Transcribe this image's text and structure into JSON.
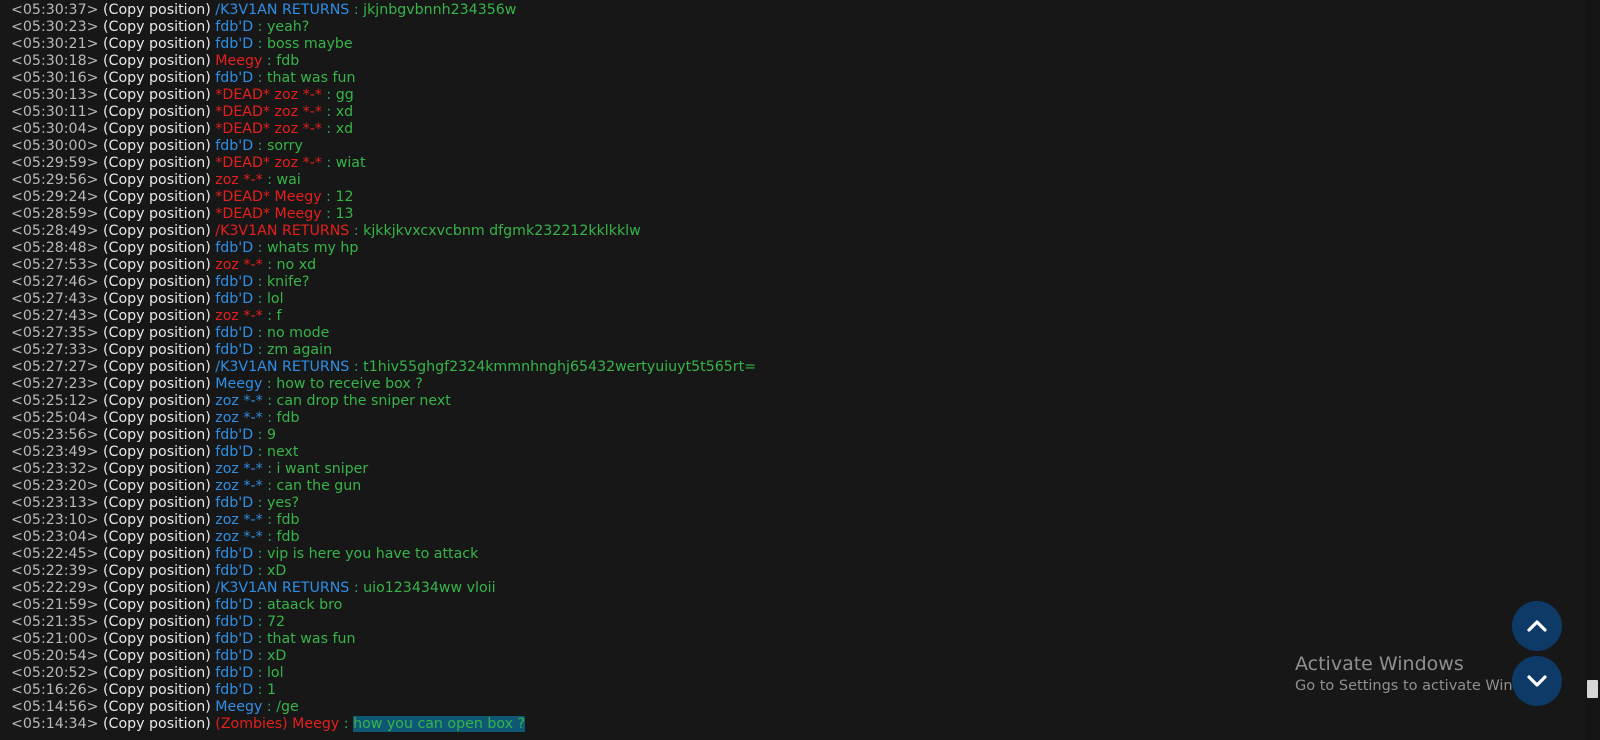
{
  "colors": {
    "background": "#171717",
    "timestamp": "#b9b9b9",
    "copy": "#e8e8e8",
    "name_blue": "#2e8fe6",
    "name_red": "#e5201c",
    "message": "#37b449",
    "selection": "#0e5876",
    "round_button": "#0d3a67"
  },
  "chat": {
    "copy_label": "(Copy position)",
    "separator": ":",
    "lines": [
      {
        "time": "<05:30:37>",
        "name": "/K3V1AN RETURNS",
        "color": "blue",
        "msg": "jkjnbgvbnnh234356w"
      },
      {
        "time": "<05:30:23>",
        "name": "fdb'D",
        "color": "blue",
        "msg": "yeah?"
      },
      {
        "time": "<05:30:21>",
        "name": "fdb'D",
        "color": "blue",
        "msg": "boss maybe"
      },
      {
        "time": "<05:30:18>",
        "name": "Meegy",
        "color": "red",
        "msg": "fdb"
      },
      {
        "time": "<05:30:16>",
        "name": "fdb'D",
        "color": "blue",
        "msg": "that was fun"
      },
      {
        "time": "<05:30:13>",
        "name": "*DEAD* zoz *-*",
        "color": "red",
        "msg": "gg"
      },
      {
        "time": "<05:30:11>",
        "name": "*DEAD* zoz *-*",
        "color": "red",
        "msg": "xd"
      },
      {
        "time": "<05:30:04>",
        "name": "*DEAD* zoz *-*",
        "color": "red",
        "msg": "xd"
      },
      {
        "time": "<05:30:00>",
        "name": "fdb'D",
        "color": "blue",
        "msg": "sorry"
      },
      {
        "time": "<05:29:59>",
        "name": "*DEAD* zoz *-*",
        "color": "red",
        "msg": "wiat"
      },
      {
        "time": "<05:29:56>",
        "name": "zoz *-*",
        "color": "red",
        "msg": "wai"
      },
      {
        "time": "<05:29:24>",
        "name": "*DEAD* Meegy",
        "color": "red",
        "msg": "12"
      },
      {
        "time": "<05:28:59>",
        "name": "*DEAD* Meegy",
        "color": "red",
        "msg": "13"
      },
      {
        "time": "<05:28:49>",
        "name": "/K3V1AN RETURNS",
        "color": "red",
        "msg": "kjkkjkvxcxvcbnm dfgmk232212kklkklw"
      },
      {
        "time": "<05:28:48>",
        "name": "fdb'D",
        "color": "blue",
        "msg": "whats my hp"
      },
      {
        "time": "<05:27:53>",
        "name": "zoz *-*",
        "color": "red",
        "msg": "no xd"
      },
      {
        "time": "<05:27:46>",
        "name": "fdb'D",
        "color": "blue",
        "msg": "knife?"
      },
      {
        "time": "<05:27:43>",
        "name": "fdb'D",
        "color": "blue",
        "msg": "lol"
      },
      {
        "time": "<05:27:43>",
        "name": "zoz *-*",
        "color": "red",
        "msg": "f"
      },
      {
        "time": "<05:27:35>",
        "name": "fdb'D",
        "color": "blue",
        "msg": "no mode"
      },
      {
        "time": "<05:27:33>",
        "name": "fdb'D",
        "color": "blue",
        "msg": "zm again"
      },
      {
        "time": "<05:27:27>",
        "name": "/K3V1AN RETURNS",
        "color": "blue",
        "msg": "t1hiv55ghgf2324kmmnhnghj65432wertyuiuyt5t565rt="
      },
      {
        "time": "<05:27:23>",
        "name": "Meegy",
        "color": "blue",
        "msg": "how to receive box ?"
      },
      {
        "time": "<05:25:12>",
        "name": "zoz *-*",
        "color": "blue",
        "msg": "can drop the sniper next"
      },
      {
        "time": "<05:25:04>",
        "name": "zoz *-*",
        "color": "blue",
        "msg": "fdb"
      },
      {
        "time": "<05:23:56>",
        "name": "fdb'D",
        "color": "blue",
        "msg": "9"
      },
      {
        "time": "<05:23:49>",
        "name": "fdb'D",
        "color": "blue",
        "msg": "next"
      },
      {
        "time": "<05:23:32>",
        "name": "zoz *-*",
        "color": "blue",
        "msg": "i want sniper"
      },
      {
        "time": "<05:23:20>",
        "name": "zoz *-*",
        "color": "blue",
        "msg": "can the gun"
      },
      {
        "time": "<05:23:13>",
        "name": "fdb'D",
        "color": "blue",
        "msg": "yes?"
      },
      {
        "time": "<05:23:10>",
        "name": "zoz *-*",
        "color": "blue",
        "msg": "fdb"
      },
      {
        "time": "<05:23:04>",
        "name": "zoz *-*",
        "color": "blue",
        "msg": "fdb"
      },
      {
        "time": "<05:22:45>",
        "name": "fdb'D",
        "color": "blue",
        "msg": "vip is here you have to attack"
      },
      {
        "time": "<05:22:39>",
        "name": "fdb'D",
        "color": "blue",
        "msg": "xD"
      },
      {
        "time": "<05:22:29>",
        "name": "/K3V1AN RETURNS",
        "color": "blue",
        "msg": "uio123434ww vloii"
      },
      {
        "time": "<05:21:59>",
        "name": "fdb'D",
        "color": "blue",
        "msg": "ataack bro"
      },
      {
        "time": "<05:21:35>",
        "name": "fdb'D",
        "color": "blue",
        "msg": "72"
      },
      {
        "time": "<05:21:00>",
        "name": "fdb'D",
        "color": "blue",
        "msg": "that was fun"
      },
      {
        "time": "<05:20:54>",
        "name": "fdb'D",
        "color": "blue",
        "msg": "xD"
      },
      {
        "time": "<05:20:52>",
        "name": "fdb'D",
        "color": "blue",
        "msg": "lol"
      },
      {
        "time": "<05:16:26>",
        "name": "fdb'D",
        "color": "blue",
        "msg": "1"
      },
      {
        "time": "<05:14:56>",
        "name": "Meegy",
        "color": "blue",
        "msg": "/ge"
      },
      {
        "time": "<05:14:34>",
        "name": "(Zombies) Meegy",
        "color": "red",
        "msg": "how you can open box ?",
        "selected": true
      }
    ]
  },
  "watermark": {
    "title": "Activate Windows",
    "subtitle": "Go to Settings to activate Windows."
  },
  "buttons": {
    "up_icon": "chevron-up-icon",
    "down_icon": "chevron-down-icon"
  }
}
